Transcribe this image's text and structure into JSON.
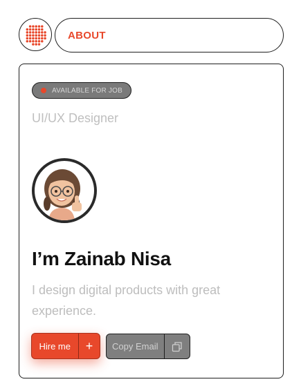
{
  "nav": {
    "logo_icon": "dotted-circle-logo-icon",
    "about_label": "ABOUT"
  },
  "profile": {
    "badge_label": "AVAILABLE FOR JOB",
    "role": "UI/UX Designer",
    "avatar_icon": "memoji-avatar-icon",
    "name": "I’m Zainab Nisa",
    "tagline": "I design digital products with great experience."
  },
  "actions": {
    "hire_label": "Hire me",
    "hire_icon": "plus-icon",
    "copy_label": "Copy Email",
    "copy_icon": "copy-icon"
  },
  "colors": {
    "accent": "#e8482b",
    "text_primary": "#111111",
    "text_muted": "#bdbdbd",
    "border": "#1d1d1d"
  }
}
